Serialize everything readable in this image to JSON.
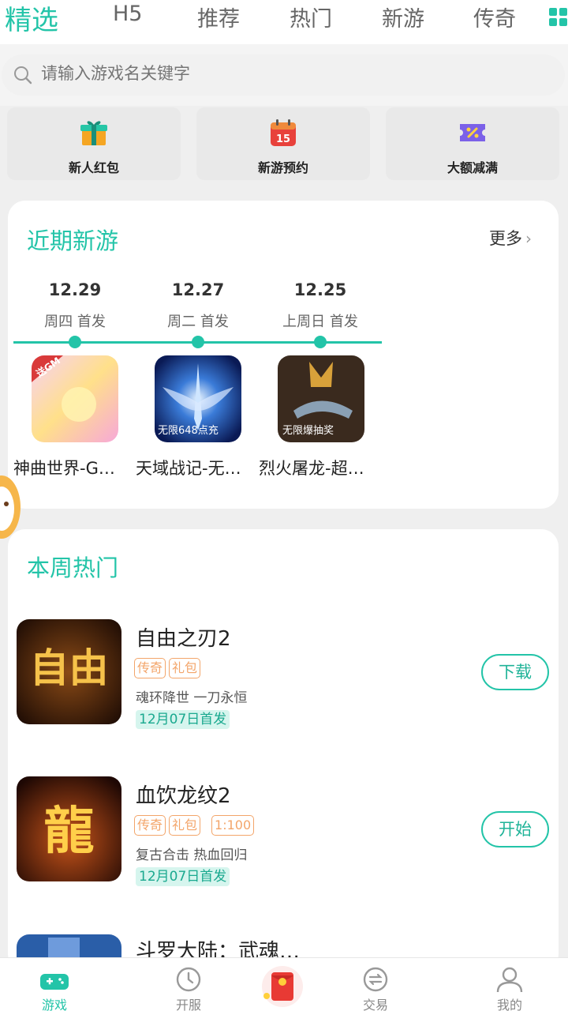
{
  "tabs": [
    {
      "label": "精选",
      "active": true
    },
    {
      "label": "H5"
    },
    {
      "label": "推荐"
    },
    {
      "label": "热门"
    },
    {
      "label": "新游"
    },
    {
      "label": "传奇"
    }
  ],
  "search": {
    "placeholder": "请输入游戏名关键字"
  },
  "quick": [
    {
      "label": "新人红包",
      "icon": "gift-icon"
    },
    {
      "label": "新游预约",
      "icon": "calendar-icon"
    },
    {
      "label": "大额减满",
      "icon": "coupon-icon"
    }
  ],
  "recent": {
    "title": "近期新游",
    "more": "更多",
    "dates": [
      {
        "date": "12.29",
        "sub": "周四 首发"
      },
      {
        "date": "12.27",
        "sub": "周二 首发"
      },
      {
        "date": "12.25",
        "sub": "上周日 首发"
      }
    ],
    "games": [
      {
        "name": "神曲世界-G…",
        "icon_text": "送GM"
      },
      {
        "name": "天域战记-无…",
        "icon_text": "无限648点充"
      },
      {
        "name": "烈火屠龙-超…",
        "icon_text": "无限爆抽奖"
      }
    ]
  },
  "hot": {
    "title": "本周热门",
    "items": [
      {
        "name": "自由之刃2",
        "tags": [
          "传奇",
          "礼包"
        ],
        "desc": "魂环降世 一刀永恒",
        "badge": "12月07日首发",
        "button": "下载",
        "icon_text": "自由"
      },
      {
        "name": "血饮龙纹2",
        "tags": [
          "传奇",
          "礼包",
          "1:100"
        ],
        "desc": "复古合击 热血回归",
        "badge": "12月07日首发",
        "button": "开始",
        "icon_text": "龍"
      },
      {
        "name": "斗罗大陆：武魂…"
      }
    ]
  },
  "nav": [
    {
      "label": "游戏",
      "active": true,
      "icon": "gamepad-icon"
    },
    {
      "label": "开服",
      "icon": "clock-icon"
    },
    {
      "label": "",
      "icon": "red-packet-icon"
    },
    {
      "label": "交易",
      "icon": "exchange-icon"
    },
    {
      "label": "我的",
      "icon": "user-icon"
    }
  ],
  "colors": {
    "accent": "#23c4a8",
    "tag": "#f3a56a"
  }
}
